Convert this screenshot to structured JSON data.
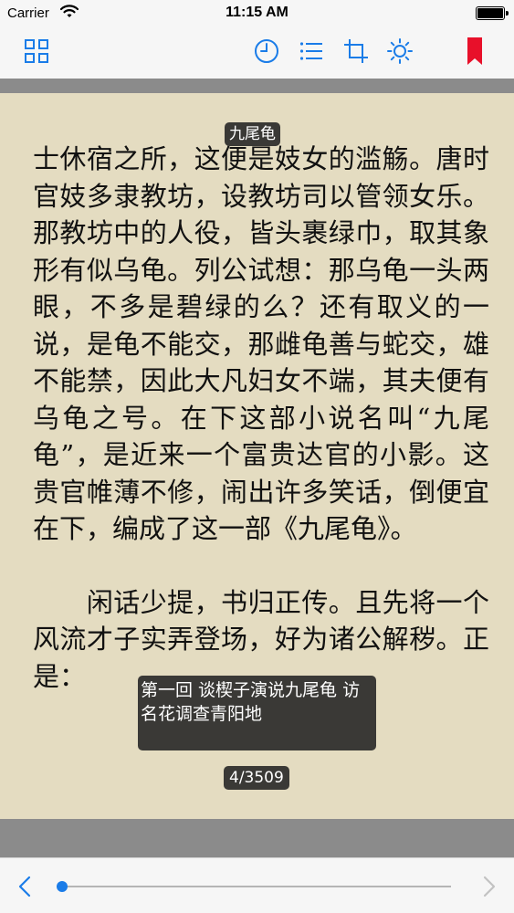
{
  "status_bar": {
    "carrier": "Carrier",
    "time": "11:15 AM",
    "battery_level": 1.0
  },
  "toolbar": {
    "accent_color": "#1a7ce8",
    "bookmark_color": "#e8102a",
    "buttons": [
      {
        "icon": "grid-icon"
      },
      {
        "icon": "clock-icon"
      },
      {
        "icon": "list-icon"
      },
      {
        "icon": "crop-icon"
      },
      {
        "icon": "brightness-icon"
      },
      {
        "icon": "bookmark-icon"
      }
    ]
  },
  "reader": {
    "background_color": "#e4dcc1",
    "book_title": "九尾龟",
    "paragraphs": [
      "士休宿之所，这便是妓女的滥觞。唐时官妓多隶教坊，设教坊司以管领女乐。那教坊中的人役，皆头裹绿巾，取其象形有似乌龟。列公试想：那乌龟一头两眼，不多是碧绿的么？还有取义的一说，是龟不能交，那雌龟善与蛇交，雄不能禁，因此大凡妇女不端，其夫便有乌龟之号。在下这部小说名叫“九尾龟”，是近来一个富贵达官的小影。这贵官帷薄不修，闹出许多笑话，倒便宜在下，编成了这一部《九尾龟》。",
      "　　闲话少提，书归正传。且先将一个风流才子实弄登场，好为诸公解秽。正是："
    ],
    "chapter_title": "第一回 谈楔子演说九尾龟 访名花调查青阳地",
    "page_indicator": "4/3509"
  },
  "bottom_bar": {
    "progress_fraction": 0.0
  }
}
